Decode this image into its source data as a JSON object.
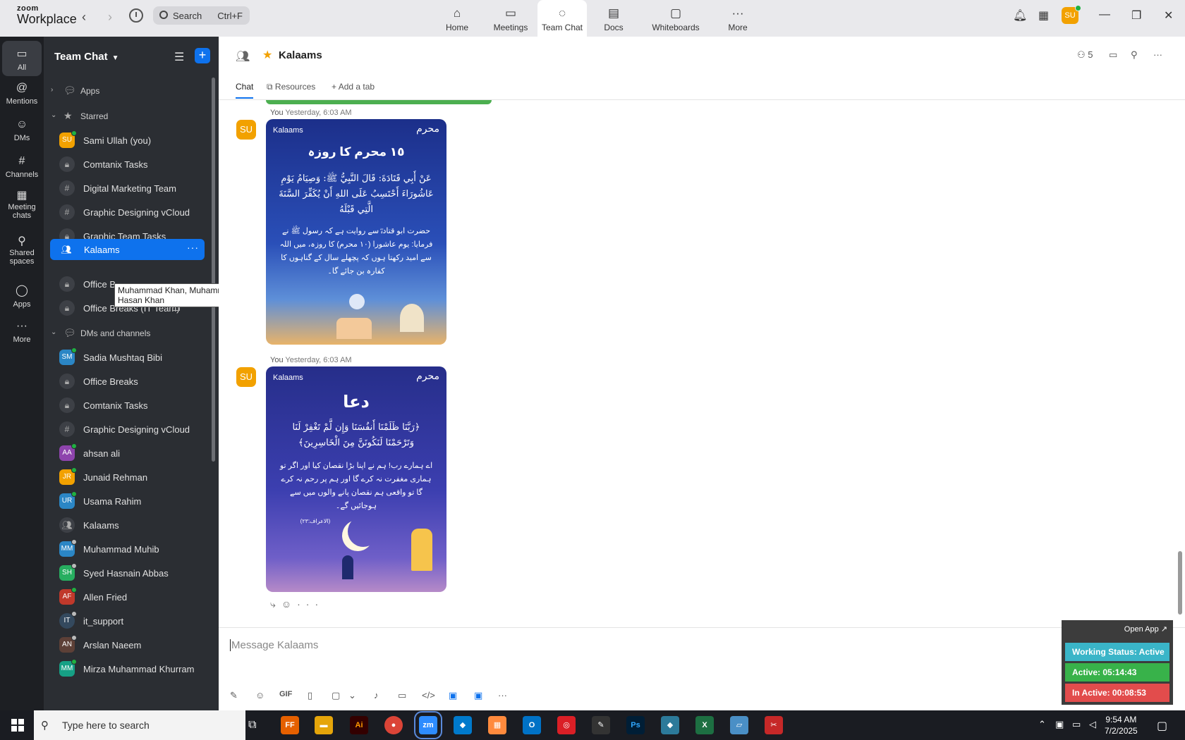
{
  "titlebar": {
    "brand_top": "zoom",
    "brand_bottom": "Workplace",
    "search_label": "Search",
    "search_shortcut": "Ctrl+F",
    "nav": [
      {
        "label": "Home",
        "icon": "⌂"
      },
      {
        "label": "Meetings",
        "icon": "▭"
      },
      {
        "label": "Team Chat",
        "icon": "◌"
      },
      {
        "label": "Docs",
        "icon": "▤"
      },
      {
        "label": "Whiteboards",
        "icon": "▢"
      },
      {
        "label": "More",
        "icon": "···"
      }
    ],
    "avatar": "SU"
  },
  "rail": [
    {
      "label": "All",
      "icon": "▭"
    },
    {
      "label": "Mentions",
      "icon": "@"
    },
    {
      "label": "DMs",
      "icon": "☺"
    },
    {
      "label": "Channels",
      "icon": "#"
    },
    {
      "label": "Meeting chats",
      "icon": "▦"
    },
    {
      "label": "Shared spaces",
      "icon": "⚲"
    },
    {
      "label": "Apps",
      "icon": "◯"
    },
    {
      "label": "More",
      "icon": "···"
    }
  ],
  "sidebar": {
    "title": "Team Chat",
    "sections": {
      "apps": "Apps",
      "starred": "Starred",
      "dms": "DMs and channels"
    },
    "starred": [
      {
        "label": "Sami Ullah (you)",
        "avatar": "SU",
        "color": "#f2a100"
      },
      {
        "label": "Comtanix Tasks"
      },
      {
        "label": "Digital Marketing Team"
      },
      {
        "label": "Graphic Designing vCloud"
      },
      {
        "label": "Graphic Team Tasks"
      },
      {
        "label": "Kalaams"
      },
      {
        "label": "Office B"
      },
      {
        "label": "Office Breaks (IT Team)"
      }
    ],
    "dms": [
      {
        "label": "Sadia Mushtaq Bibi",
        "avatar": "SM",
        "color": "#2b86c5"
      },
      {
        "label": "Office Breaks"
      },
      {
        "label": "Comtanix Tasks"
      },
      {
        "label": "Graphic Designing vCloud"
      },
      {
        "label": "ahsan ali",
        "avatar": "AA",
        "color": "#8e44ad"
      },
      {
        "label": "Junaid Rehman",
        "avatar": "JR",
        "color": "#f2a100"
      },
      {
        "label": "Usama Rahim",
        "avatar": "UR",
        "color": "#2b86c5"
      },
      {
        "label": "Kalaams"
      },
      {
        "label": "Muhammad Muhib",
        "avatar": "MM",
        "color": "#2b86c5"
      },
      {
        "label": "Syed Hasnain Abbas",
        "avatar": "SH",
        "color": "#27ae60"
      },
      {
        "label": "Allen Fried",
        "avatar": "AF",
        "color": "#c0392b"
      },
      {
        "label": "it_support",
        "avatar": "IT",
        "color": "#34495e"
      },
      {
        "label": "Arslan Naeem",
        "avatar": "AN",
        "color": "#5d4037"
      },
      {
        "label": "Mirza Muhammad Khurram",
        "avatar": "MM",
        "color": "#16a085"
      }
    ],
    "tooltip": "Muhammad Khan, Muhammad Muhib, Junaid Rehman, Hasan Khan"
  },
  "main": {
    "title": "Kalaams",
    "member_count": "5",
    "tabs": {
      "chat": "Chat",
      "resources": "Resources",
      "add": "Add a tab"
    },
    "messages": [
      {
        "avatar": "SU",
        "sender": "You",
        "time": "Yesterday, 6:03 AM",
        "logo": "Kalaams",
        "badge": "محرم",
        "title": "١٥ محرم کا روزہ",
        "arabic": "عَنْ أَبِي قَتَادَةَ: قَالَ النَّبِيُّ ﷺ: وَصِيَامُ يَوْمِ عَاشُورَاءَ أَحْتَسِبُ عَلَى اللهِ أَنْ يُكَفِّرَ السَّنَةَ الَّتِي قَبْلَهُ",
        "urdu": "حضرت ابو قتادہؓ سے روایت ہے کہ رسول ﷺ نے فرمایا: یوم عاشورا (١٠ محرم) کا روزہ، میں اللہ سے امید رکھتا ہوں کہ پچھلے سال کے گناہوں کا کفارہ بن جائے گا۔"
      },
      {
        "avatar": "SU",
        "sender": "You",
        "time": "Yesterday, 6:03 AM",
        "logo": "Kalaams",
        "badge": "محرم",
        "title": "دعا",
        "arabic": "﴿رَبَّنَا ظَلَمْنَا أَنفُسَنَا وَإِن لَّمْ تَغْفِرْ لَنَا وَتَرْحَمْنَا لَنَكُونَنَّ مِنَ الْخَاسِرِينَ﴾",
        "urdu": "اے ہمارے رب! ہم نے اپنا بڑا نقصان کیا اور اگر تو ہماری مغفرت نہ کرے گا اور ہم پر رحم نہ کرے گا تو واقعی ہم نقصان پانے والوں میں سے ہوجائیں گے۔",
        "ref": "(الاعراف:٢٣)"
      }
    ],
    "composer_placeholder": "Message Kalaams",
    "tools": [
      "✎",
      "☺",
      "GIF",
      "▯",
      "▢",
      "⌄",
      "♪",
      "▭",
      "</>",
      "▣",
      "▣",
      "···"
    ]
  },
  "widget": {
    "open_app": "Open App ↗",
    "status": "Working Status: Active",
    "active": "Active: 05:14:43",
    "inactive": "In Active: 00:08:53",
    "colors": {
      "status": "#3ab5c8",
      "active": "#38b24a",
      "inactive": "#e24c4c"
    }
  },
  "taskbar": {
    "search": "Type here to search",
    "time": "9:54 AM",
    "date": "7/2/2025",
    "apps": [
      {
        "label": "FF",
        "color": "#e66000"
      },
      {
        "label": "▬",
        "color": "#e5a50a"
      },
      {
        "label": "Ai",
        "color": "#330000"
      },
      {
        "label": "●",
        "color": "#db4437"
      },
      {
        "label": "zm",
        "color": "#2d8cff"
      },
      {
        "label": "◆",
        "color": "#007acc"
      },
      {
        "label": "▦",
        "color": "#ff8a3d"
      },
      {
        "label": "O",
        "color": "#0072c6"
      },
      {
        "label": "◎",
        "color": "#da1f26"
      },
      {
        "label": "✎",
        "color": "#333"
      },
      {
        "label": "Ps",
        "color": "#001e36"
      },
      {
        "label": "◆",
        "color": "#2c7a9a"
      },
      {
        "label": "X",
        "color": "#1d6f42"
      },
      {
        "label": "▱",
        "color": "#4a8fc6"
      },
      {
        "label": "✂",
        "color": "#c62828"
      }
    ]
  }
}
